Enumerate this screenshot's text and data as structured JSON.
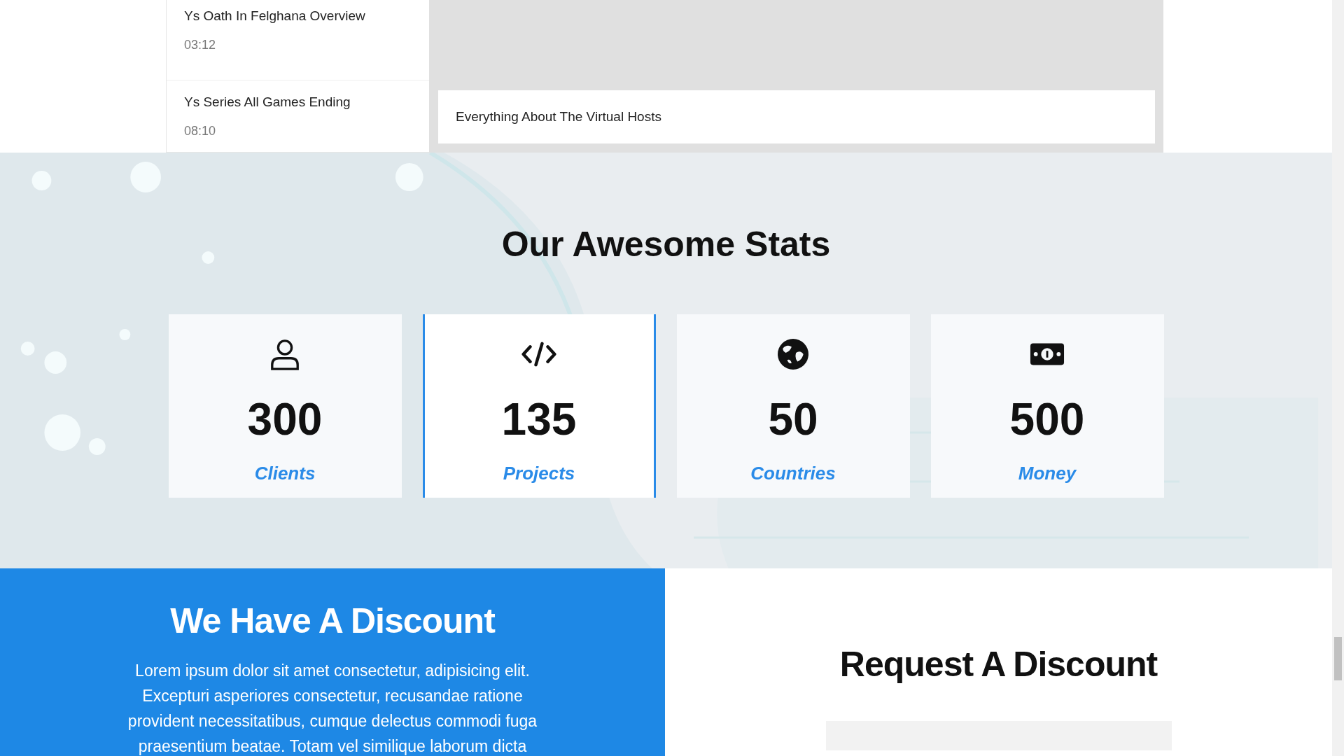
{
  "videos": {
    "items": [
      {
        "title": "Ys Oath In Felghana Overview",
        "duration": "03:12"
      },
      {
        "title": "Ys Series All Games Ending",
        "duration": "08:10"
      }
    ],
    "preview": {
      "title": "Everything About The Virtual Hosts"
    }
  },
  "stats": {
    "title": "Our Awesome Stats",
    "items": [
      {
        "kind": "user",
        "number": "300",
        "label": "Clients",
        "selected": false
      },
      {
        "kind": "code",
        "number": "135",
        "label": "Projects",
        "selected": true
      },
      {
        "kind": "globe",
        "number": "50",
        "label": "Countries",
        "selected": false
      },
      {
        "kind": "money",
        "number": "500",
        "label": "Money",
        "selected": false
      }
    ]
  },
  "discount": {
    "title": "We Have A Discount",
    "text": "Lorem ipsum dolor sit amet consectetur, adipisicing elit. Excepturi asperiores consectetur, recusandae ratione provident necessitatibus, cumque delectus commodi fuga praesentium beatae. Totam vel similique laborum dicta"
  },
  "request": {
    "title": "Request A Discount"
  }
}
